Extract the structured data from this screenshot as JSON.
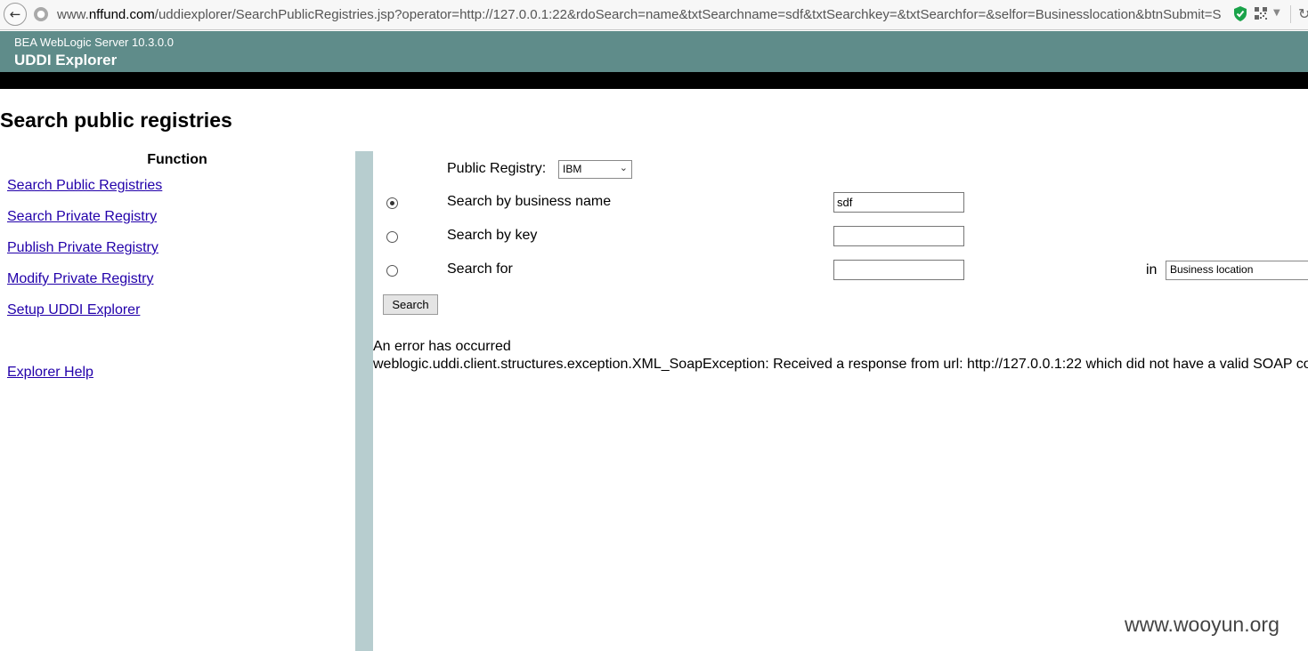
{
  "browser": {
    "url_prefix": "www.",
    "url_host": "nffund.com",
    "url_rest": "/uddiexplorer/SearchPublicRegistries.jsp?operator=http://127.0.0.1:22&rdoSearch=name&txtSearchname=sdf&txtSearchkey=&txtSearchfor=&selfor=Businesslocation&btnSubmit=S"
  },
  "header": {
    "product": "BEA WebLogic Server 10.3.0.0",
    "title": "UDDI Explorer"
  },
  "page": {
    "title": "Search public registries"
  },
  "nav": {
    "heading": "Function",
    "items": [
      {
        "label": "Search Public Registries"
      },
      {
        "label": "Search Private Registry"
      },
      {
        "label": "Publish Private Registry"
      },
      {
        "label": "Modify Private Registry"
      },
      {
        "label": "Setup UDDI Explorer"
      }
    ],
    "help": "Explorer Help"
  },
  "form": {
    "registry_label": "Public Registry:",
    "registry_value": "IBM",
    "options": [
      {
        "label": "Search by business name",
        "value": "sdf",
        "checked": true
      },
      {
        "label": "Search by key",
        "value": "",
        "checked": false
      },
      {
        "label": "Search for",
        "value": "",
        "checked": false
      }
    ],
    "in_label": "in",
    "in_value": "Business location",
    "submit_label": "Search"
  },
  "error": {
    "heading": "An error has occurred",
    "message": "weblogic.uddi.client.structures.exception.XML_SoapException: Received a response from url: http://127.0.0.1:22 which did not have a valid SOAP co"
  },
  "watermark": "www.wooyun.org"
}
